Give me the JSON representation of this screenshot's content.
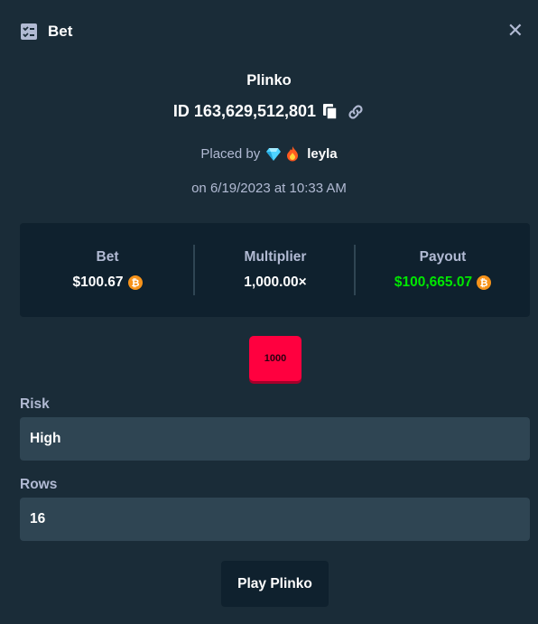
{
  "header": {
    "title": "Bet",
    "close_glyph": "✕"
  },
  "game": {
    "name": "Plinko",
    "bet_id": "ID 163,629,512,801"
  },
  "placed": {
    "prefix": "Placed by",
    "username": "leyla",
    "badges": [
      "gem-icon",
      "fire-icon"
    ],
    "date": "on 6/19/2023 at 10:33 AM"
  },
  "stats": [
    {
      "label": "Bet",
      "value": "$100.67",
      "coin": true,
      "color": "#ffffff"
    },
    {
      "label": "Multiplier",
      "value": "1,000.00×",
      "coin": false,
      "color": "#ffffff"
    },
    {
      "label": "Payout",
      "value": "$100,665.07",
      "coin": true,
      "color": "#00e701"
    }
  ],
  "result_tile": {
    "label": "1000",
    "color": "#ff003f"
  },
  "risk": {
    "label": "Risk",
    "value": "High"
  },
  "rows": {
    "label": "Rows",
    "value": "16"
  },
  "action": {
    "label": "Play Plinko"
  },
  "colors": {
    "background": "#1a2c38",
    "panel": "#0f212e",
    "input": "#2f4553",
    "muted_text": "#b1bad3",
    "win_green": "#00e701",
    "bitcoin_orange": "#f7931a"
  }
}
